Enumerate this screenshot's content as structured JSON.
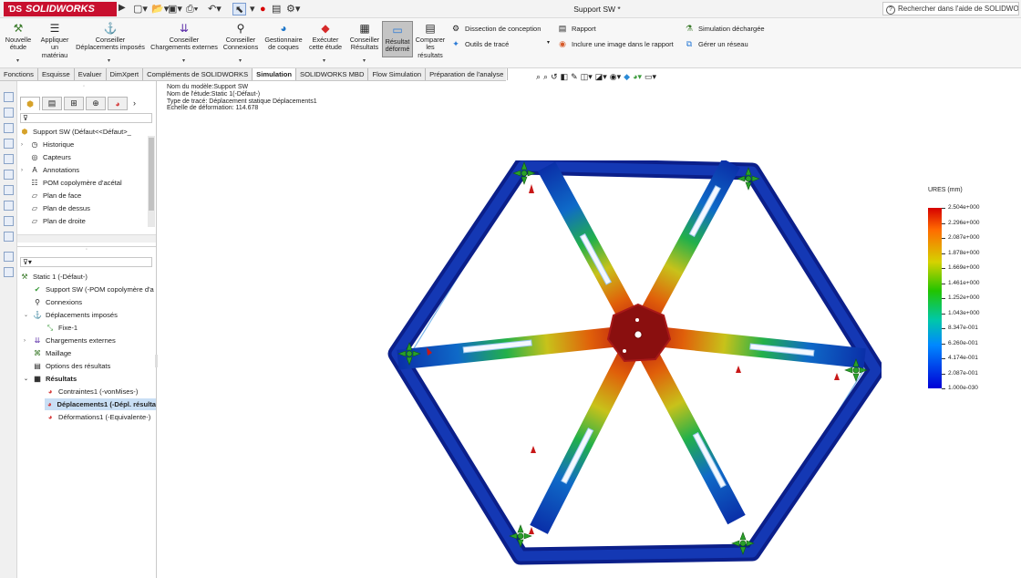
{
  "app": {
    "brand": "SOLIDWORKS",
    "doc_title": "Support SW *",
    "help_placeholder": "Rechercher dans l'aide de SOLIDWORKS"
  },
  "ribbon": {
    "new_study": "Nouvelle\nétude",
    "apply_material": "Appliquer\nun\nmatériau",
    "fixtures": "Conseiller\nDéplacements imposés",
    "external_loads": "Conseiller\nChargements externes",
    "connections": "Conseiller\nConnexions",
    "shells": "Gestionnaire\nde coques",
    "run": "Exécuter\ncette étude",
    "results_advisor": "Conseiller\nRésultats",
    "deformed": "Résultat\ndéformé",
    "compare": "Comparer\nles\nrésultats",
    "design_insight": "Dissection de conception",
    "plot_tools": "Outils de tracé",
    "report": "Rapport",
    "include_image": "Inclure une image dans le rapport",
    "offloaded": "Simulation déchargée",
    "manage_network": "Gérer un réseau"
  },
  "tabs": [
    "Fonctions",
    "Esquisse",
    "Evaluer",
    "DimXpert",
    "Compléments de SOLIDWORKS",
    "Simulation",
    "SOLIDWORKS MBD",
    "Flow Simulation",
    "Préparation de l'analyse"
  ],
  "active_tab": "Simulation",
  "feature_tree": {
    "root": "Support SW  (Défaut<<Défaut>_",
    "items": [
      "Historique",
      "Capteurs",
      "Annotations",
      "POM copolymère d'acétal",
      "Plan de face",
      "Plan de dessus",
      "Plan de droite"
    ]
  },
  "study_tree": {
    "study": "Static 1 (-Défaut-)",
    "part": "Support SW (-POM copolymère d'a",
    "connections": "Connexions",
    "fixtures": "Déplacements imposés",
    "fixture_1": "Fixe-1",
    "external_loads": "Chargements externes",
    "mesh": "Maillage",
    "result_options": "Options des résultats",
    "results": "Résultats",
    "stress": "Contraintes1 (-vonMises-)",
    "displacement": "Déplacements1 (-Dépl. résulta",
    "strain": "Déformations1 (-Equivalente-)"
  },
  "plot_info": {
    "model_name": "Nom du modèle:Support SW",
    "study_name": "Nom de l'étude:Static 1(-Défaut-)",
    "plot_type": "Type de tracé: Déplacement statique Déplacements1",
    "deformation_scale": "Echelle de déformation: 114.678"
  },
  "legend": {
    "title": "URES (mm)",
    "labels": [
      "2.504e+000",
      "2.296e+000",
      "2.087e+000",
      "1.878e+000",
      "1.669e+000",
      "1.461e+000",
      "1.252e+000",
      "1.043e+000",
      "8.347e-001",
      "6.260e-001",
      "4.174e-001",
      "2.087e-001",
      "1.000e-030"
    ],
    "color_max": "#d60000",
    "color_min": "#0000d6"
  }
}
